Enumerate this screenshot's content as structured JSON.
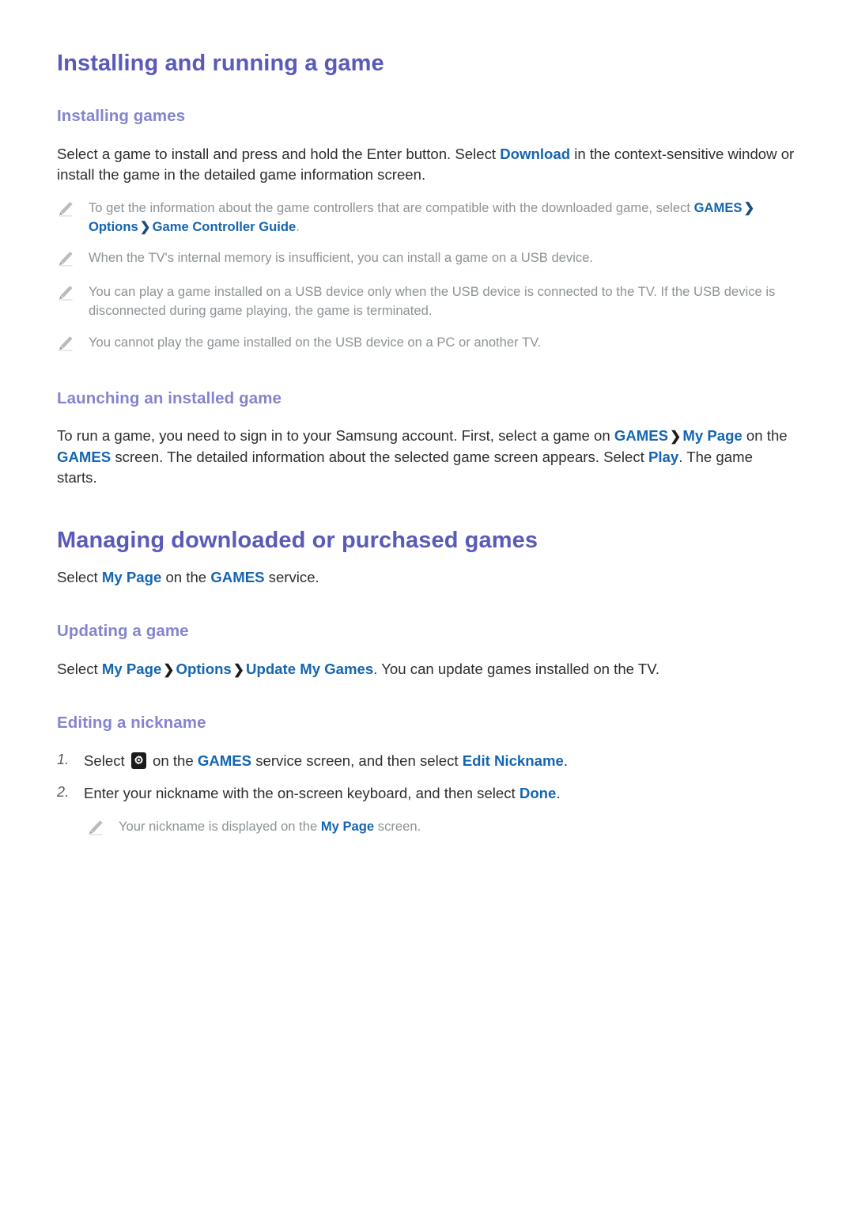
{
  "document": {
    "sections": [
      {
        "id": "installing-and-running-a-game",
        "title": "Installing and running a game",
        "subsections": [
          {
            "id": "installing-games",
            "title": "Installing games",
            "paragraph": {
              "t1": "Select a game to install and press and hold the Enter button. Select ",
              "link1": "Download",
              "t2": " in the context-sensitive window or install the game in the detailed game information screen."
            },
            "notes": [
              {
                "t1": "To get the information about the game controllers that are compatible with the downloaded game, select ",
                "link1": "GAMES",
                "sep1": "❯",
                "link2": "Options",
                "sep2": "❯",
                "link3": "Game Controller Guide",
                "t2": "."
              },
              {
                "t1": "When the TV's internal memory is insufficient, you can install a game on a USB device."
              },
              {
                "t1": "You can play a game installed on a USB device only when the USB device is connected to the TV. If the USB device is disconnected during game playing, the game is terminated."
              },
              {
                "t1": "You cannot play the game installed on the USB device on a PC or another TV."
              }
            ]
          },
          {
            "id": "launching-an-installed-game",
            "title": "Launching an installed game",
            "paragraph": {
              "t1": "To run a game, you need to sign in to your Samsung account. First, select a game on ",
              "link1": "GAMES",
              "sep1": "❯",
              "link2": "My Page",
              "t2": " on the ",
              "link3": "GAMES",
              "t3": " screen. The detailed information about the selected game screen appears. Select ",
              "link4": "Play",
              "t4": ". The game starts."
            }
          }
        ]
      },
      {
        "id": "managing-downloaded-or-purchased-games",
        "title": "Managing downloaded or purchased games",
        "intro": {
          "t1": "Select ",
          "link1": "My Page",
          "t2": " on the ",
          "link2": "GAMES",
          "t3": " service."
        },
        "subsections": [
          {
            "id": "updating-a-game",
            "title": "Updating a game",
            "paragraph": {
              "t1": "Select ",
              "link1": "My Page",
              "sep1": "❯",
              "link2": "Options",
              "sep2": "❯",
              "link3": "Update My Games",
              "t2": ". You can update games installed on the TV."
            }
          },
          {
            "id": "editing-a-nickname",
            "title": "Editing a nickname",
            "steps": [
              {
                "num": "1.",
                "t1": "Select ",
                "icon": "gear-icon",
                "t2": " on the ",
                "link1": "GAMES",
                "t3": " service screen, and then select ",
                "link2": "Edit Nickname",
                "t4": "."
              },
              {
                "num": "2.",
                "t1": "Enter your nickname with the on-screen keyboard, and then select ",
                "link1": "Done",
                "t2": "."
              }
            ],
            "notes": [
              {
                "t1": "Your nickname is displayed on the ",
                "link1": "My Page",
                "t2": " screen."
              }
            ]
          }
        ]
      }
    ],
    "icons": {
      "note_bullet": "pencil-icon",
      "breadcrumb_separator": "chevron-right-icon",
      "settings": "gear-icon"
    },
    "colors": {
      "h1": "#5a5ab8",
      "h2": "#8484cf",
      "link": "#1565b0",
      "body": "#2e2e2e",
      "note": "#8d9396",
      "background": "#ffffff"
    }
  }
}
